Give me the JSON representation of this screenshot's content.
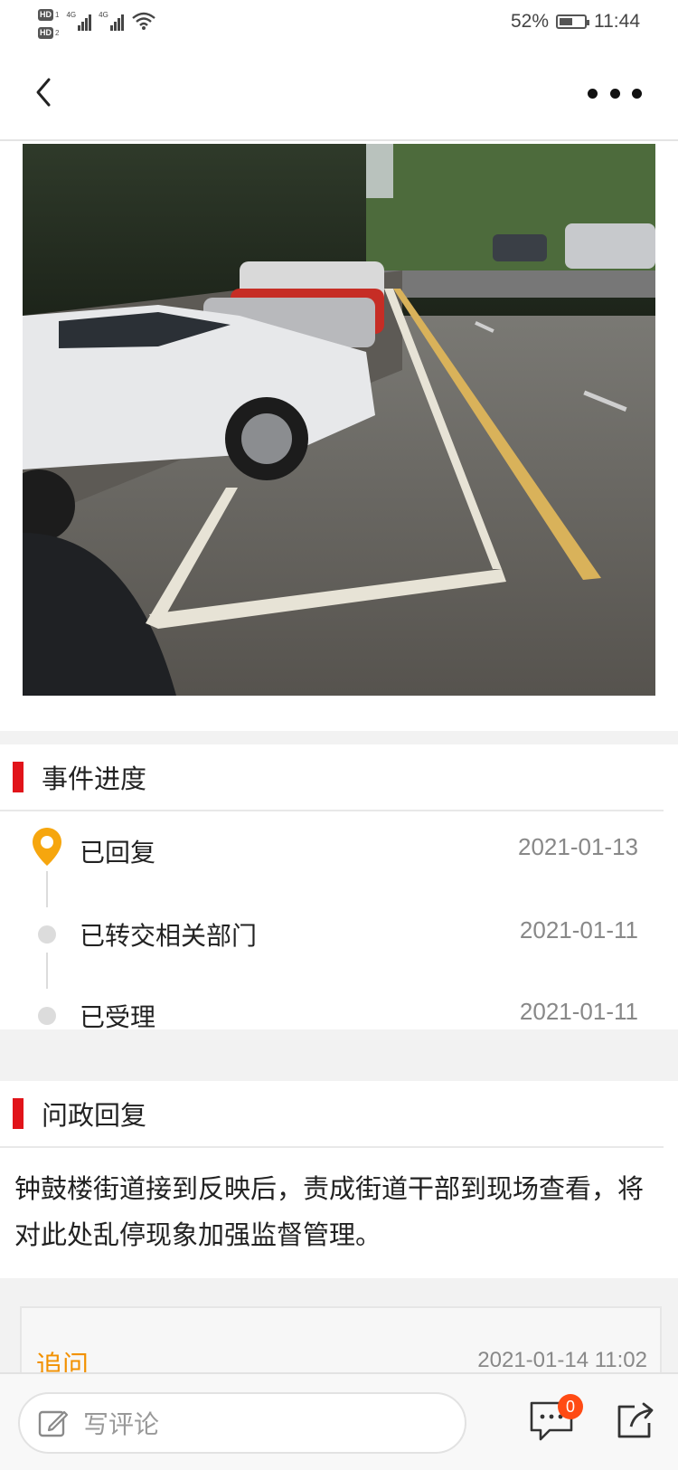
{
  "status_bar": {
    "hd1": "HD",
    "hd1_sub": "1",
    "hd2": "HD",
    "hd2_sub": "2",
    "net1": "4G",
    "net2": "4G",
    "battery_percent": "52%",
    "battery_level": 0.52,
    "time": "11:44"
  },
  "nav": {
    "back_icon": "chevron-left-icon",
    "more_icon": "more-dots-icon"
  },
  "progress": {
    "title": "事件进度",
    "items": [
      {
        "label": "已回复",
        "date": "2021-01-13",
        "icon": "location-pin-icon"
      },
      {
        "label": "已转交相关部门",
        "date": "2021-01-11",
        "icon": "dot-icon"
      },
      {
        "label": "已受理",
        "date": "2021-01-11",
        "icon": "dot-icon"
      }
    ]
  },
  "reply": {
    "title": "问政回复",
    "text": "钟鼓楼街道接到反映后，责成街道干部到现场查看，将对此处乱停现象加强监督管理。"
  },
  "followup": {
    "title": "追问",
    "date": "2021-01-14 11:02"
  },
  "bottom": {
    "comment_placeholder": "写评论",
    "message_badge": "0",
    "pen_icon": "edit-icon",
    "message_icon": "comment-bubble-icon",
    "share_icon": "share-icon"
  },
  "colors": {
    "accent_red": "#e1141a",
    "accent_orange": "#f29100",
    "badge_orange": "#ff4b14"
  }
}
